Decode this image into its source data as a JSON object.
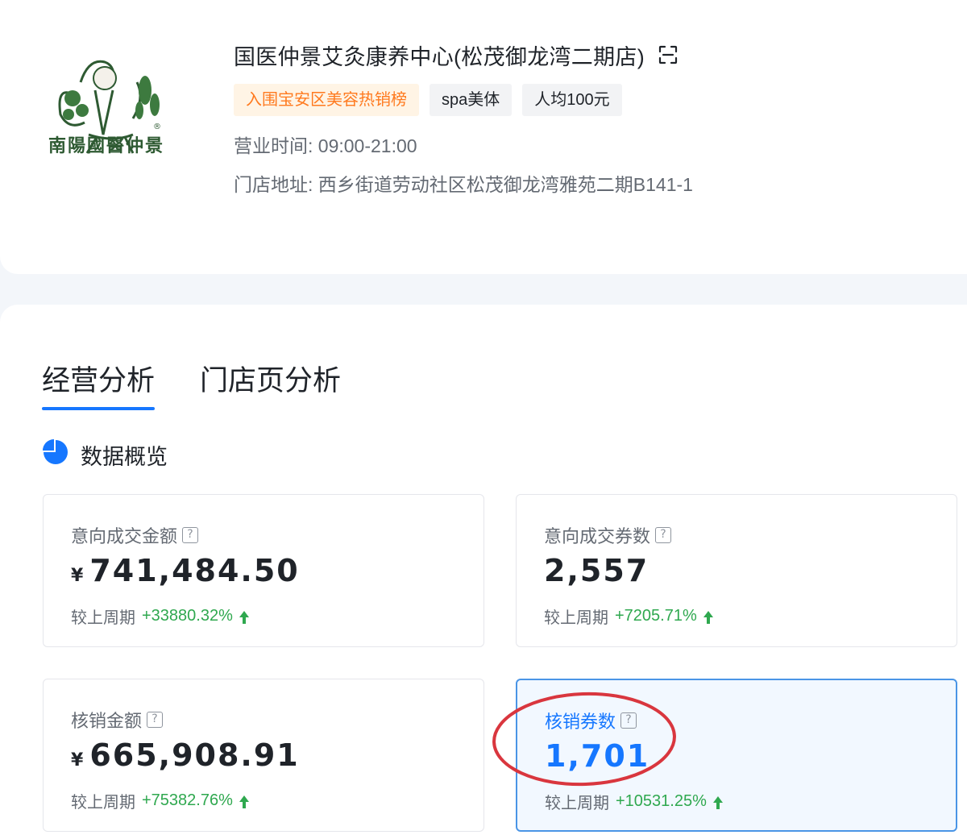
{
  "store": {
    "logo_text": "南陽國醫仲景",
    "name": "国医仲景艾灸康养中心(松茂御龙湾二期店)",
    "tags": [
      "入围宝安区美容热销榜",
      "spa美体",
      "人均100元"
    ],
    "hours_label": "营业时间:",
    "hours_value": "09:00-21:00",
    "address_label": "门店地址:",
    "address_value": "西乡街道劳动社区松茂御龙湾雅苑二期B141-1"
  },
  "tabs": [
    {
      "label": "经营分析",
      "active": true
    },
    {
      "label": "门店页分析",
      "active": false
    }
  ],
  "section": {
    "title": "数据概览"
  },
  "metrics": [
    {
      "label": "意向成交金额",
      "currency": "¥",
      "value": "741,484.50",
      "compare_label": "较上周期",
      "delta": "+33880.32%"
    },
    {
      "label": "意向成交券数",
      "currency": "",
      "value": "2,557",
      "compare_label": "较上周期",
      "delta": "+7205.71%"
    },
    {
      "label": "核销金额",
      "currency": "¥",
      "value": "665,908.91",
      "compare_label": "较上周期",
      "delta": "+75382.76%"
    },
    {
      "label": "核销券数",
      "currency": "",
      "value": "1,701",
      "compare_label": "较上周期",
      "delta": "+10531.25%"
    }
  ],
  "icons": {
    "scan": "scan-icon",
    "help": "question-icon",
    "trend_up": "arrow-up-icon",
    "section": "pie-chart-icon",
    "help_glyph": "?"
  },
  "colors": {
    "accent": "#1677ff",
    "positive": "#2fa84f",
    "hot_tag_text": "#ff7a1f",
    "hot_tag_bg": "#fff4e5",
    "annotation": "#d9363e"
  }
}
